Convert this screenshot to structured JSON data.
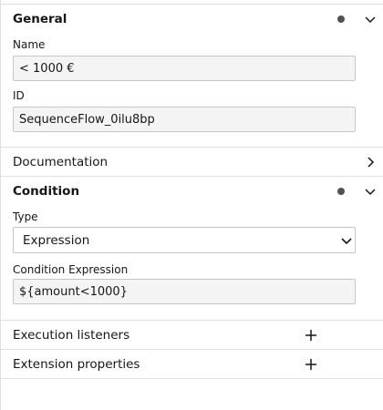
{
  "general": {
    "title": "General",
    "name_label": "Name",
    "name_value": "< 1000 €",
    "id_label": "ID",
    "id_value": "SequenceFlow_0ilu8bp"
  },
  "documentation": {
    "title": "Documentation"
  },
  "condition": {
    "title": "Condition",
    "type_label": "Type",
    "type_value": "Expression",
    "expression_label": "Condition Expression",
    "expression_value": "${amount<1000}"
  },
  "execution_listeners": {
    "title": "Execution listeners"
  },
  "extension_properties": {
    "title": "Extension properties"
  },
  "icons": {
    "dot": "status-dot-icon",
    "expand": "chevron-down-icon",
    "collapsed": "chevron-right-icon",
    "add": "plus-icon"
  },
  "colors": {
    "border": "#e0e0e0",
    "input_bg": "#f4f4f4",
    "text": "#161616",
    "dot": "#525252"
  }
}
